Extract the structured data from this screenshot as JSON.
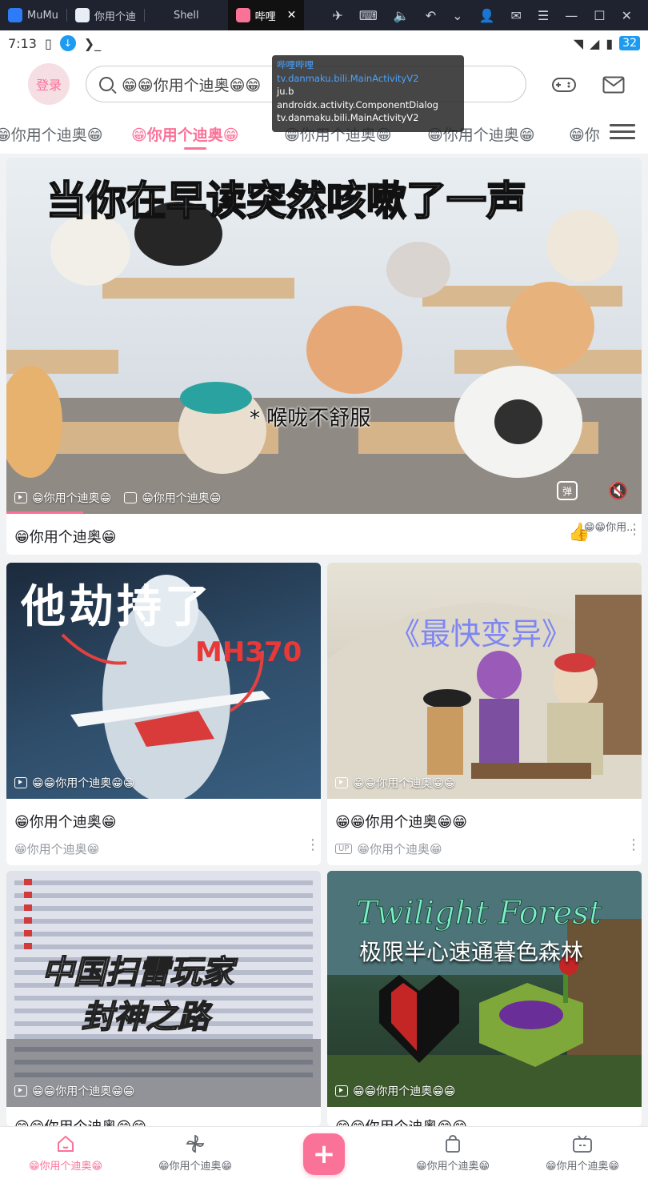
{
  "emulator": {
    "tabs": [
      {
        "label": "MuMu",
        "icon": "mumu-icon"
      },
      {
        "label": "你用个迪",
        "icon": "app-icon"
      },
      {
        "label": "Shell",
        "icon": ""
      },
      {
        "label": "哔哩",
        "icon": "bilibili-icon"
      }
    ]
  },
  "status_bar": {
    "time": "7:13",
    "battery_level": "32"
  },
  "header": {
    "login_label": "登录",
    "search_placeholder": "😁😁你用个迪奥😁😁"
  },
  "tooltip": {
    "lines": [
      "哔哩哔哩",
      "tv.danmaku.bili.MainActivityV2",
      "ju.b",
      "androidx.activity.ComponentDialog",
      "tv.danmaku.bili.MainActivityV2"
    ]
  },
  "categories": [
    {
      "label": "😁你用个迪奥😁"
    },
    {
      "label": "😁你用个迪奥😁"
    },
    {
      "label": "😁你用个迪奥😁"
    },
    {
      "label": "😁你用个迪奥😁"
    },
    {
      "label": "😁你"
    }
  ],
  "featured": {
    "headline": "当你在早读突然咳嗽了一声",
    "caption": "* 喉咙不舒服",
    "play_count": "😁你用个迪奥😁",
    "danmaku_count": "😁你用个迪奥😁",
    "title": "😁你用个迪奥😁",
    "like_count": "😁😁你用..."
  },
  "cards": [
    {
      "thumb_text": "他劫持了",
      "thumb_text2": "MH370",
      "meta": "😁😁你用个迪奥😁😁",
      "title": "😁你用个迪奥😁",
      "sub": "😁你用个迪奥😁"
    },
    {
      "thumb_text": "《最快变异》",
      "meta": "😁😁你用个迪奥😁😁",
      "title": "😁😁你用个迪奥😁😁",
      "sub": "😁你用个迪奥😁",
      "up_label": "UP"
    },
    {
      "thumb_text": "中国扫雷玩家",
      "thumb_text2": "封神之路",
      "meta": "😁😁你用个迪奥😁😁",
      "title": "😁😁你用个迪奥😁😁"
    },
    {
      "thumb_text": "Twilight Forest",
      "thumb_text2": "极限半心速通暮色森林",
      "meta": "😁😁你用个迪奥😁😁",
      "title": "😁😁你用个迪奥😁😁"
    }
  ],
  "bottom_nav": [
    {
      "label": "😁你用个迪奥😁",
      "icon": "home-icon"
    },
    {
      "label": "😁你用个迪奥😁",
      "icon": "pinwheel-icon"
    },
    {
      "label": "😁你用个迪奥😁",
      "icon": "shopping-bag-icon"
    },
    {
      "label": "😁你用个迪奥😁",
      "icon": "tv-icon"
    }
  ],
  "colors": {
    "accent": "#fb7299",
    "emulator_bar": "#1f2330"
  }
}
